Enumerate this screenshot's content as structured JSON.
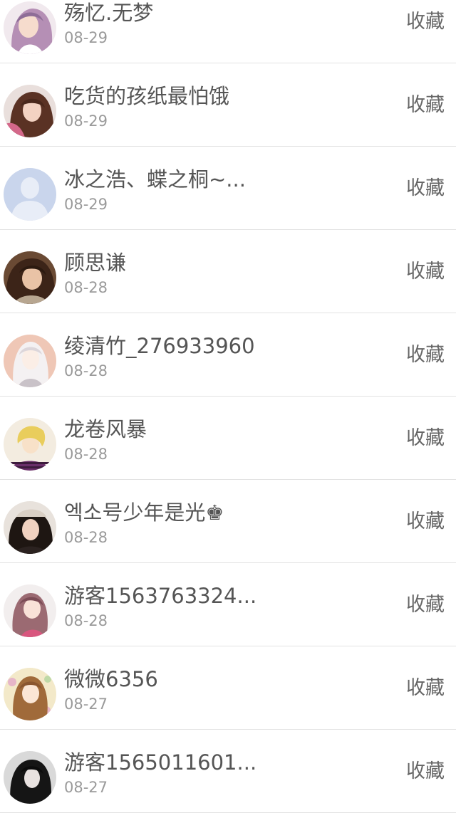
{
  "favorite_label": "收藏",
  "rows": [
    {
      "name": "殇忆.无梦",
      "date": "08-29",
      "avatar": "anime-girl-avatar"
    },
    {
      "name": "吃货的孩纸最怕饿",
      "date": "08-29",
      "avatar": "girl-photo-avatar"
    },
    {
      "name": "冰之浩、蝶之桐~...",
      "date": "08-29",
      "avatar": "default-user-avatar"
    },
    {
      "name": "顾思谦",
      "date": "08-28",
      "avatar": "girl-photo-avatar"
    },
    {
      "name": "绫清竹_276933960",
      "date": "08-28",
      "avatar": "anime-girl-avatar"
    },
    {
      "name": "龙卷风暴",
      "date": "08-28",
      "avatar": "anime-boy-avatar"
    },
    {
      "name": "엑소号少年是光♚",
      "date": "08-28",
      "avatar": "girl-photo-avatar"
    },
    {
      "name": "游客1563763324...",
      "date": "08-28",
      "avatar": "anime-girl-avatar"
    },
    {
      "name": "微微6356",
      "date": "08-27",
      "avatar": "anime-girl-avatar"
    },
    {
      "name": "游客1565011601...",
      "date": "08-27",
      "avatar": "girl-photo-avatar"
    }
  ]
}
